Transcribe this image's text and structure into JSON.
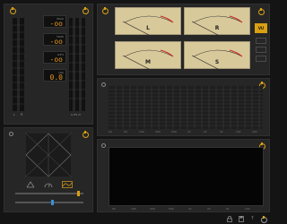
{
  "loudness": {
    "fields": [
      {
        "caption": "PEAK",
        "value": "-oo"
      },
      {
        "caption": "TRUE",
        "value": "-oo"
      },
      {
        "caption": "LUFS",
        "value": "-oo"
      },
      {
        "caption": "LRA",
        "value": "0.0"
      }
    ],
    "channel_labels": {
      "left": "L",
      "right": "R"
    },
    "bottom_label": "LUFS M"
  },
  "vu": {
    "meters": [
      "L",
      "R",
      "M",
      "S"
    ],
    "mode_button": "VU",
    "side_buttons": [
      "",
      "",
      ""
    ]
  },
  "spectrum": {
    "x_ticks": [
      "20",
      "50",
      "100",
      "200",
      "500",
      "1k",
      "2k",
      "5k",
      "10k",
      "20k"
    ]
  },
  "spectrogram": {
    "x_ticks": [
      "50",
      "100",
      "200",
      "500",
      "1k",
      "2k",
      "5k",
      "10k"
    ]
  },
  "goniometer": {
    "corner_labels": {
      "top": "",
      "left": "",
      "right": ""
    },
    "mode_icons": [
      "scope-icon",
      "dial-icon",
      "curve-icon"
    ],
    "sliders": [
      {
        "position": 0.93
      },
      {
        "position": 0.55
      }
    ]
  },
  "colors": {
    "accent": "#d9a013",
    "panel": "#262626",
    "background": "#141414",
    "meter_face": "#d8c99b",
    "readout": "#e89a1c"
  },
  "status_bar": {
    "icons": [
      "lock-icon",
      "save-icon",
      "help-icon",
      "power-icon"
    ],
    "help_label": "?"
  }
}
